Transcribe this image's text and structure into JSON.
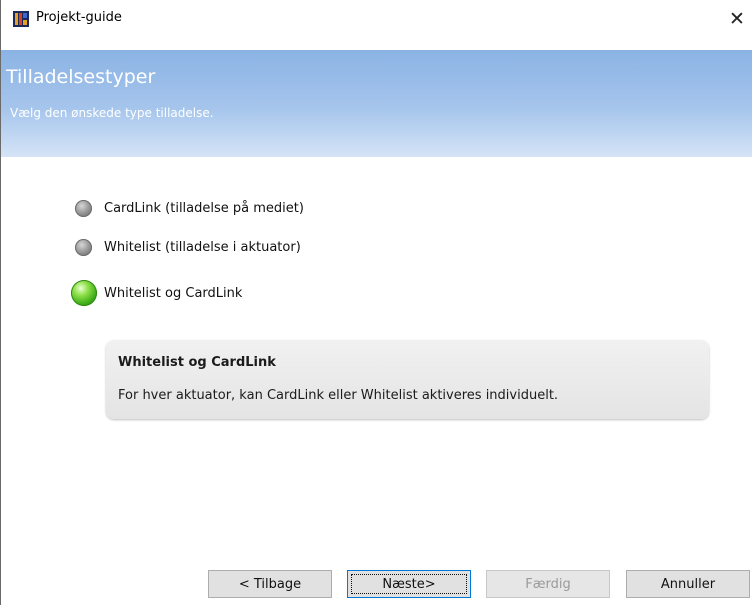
{
  "window": {
    "title": "Projekt-guide",
    "close_symbol": "✕"
  },
  "header": {
    "title": "Tilladelsestyper",
    "subtitle": "Vælg den ønskede type tilladelse."
  },
  "options": [
    {
      "label": "CardLink (tilladelse på mediet)",
      "selected": false
    },
    {
      "label": "Whitelist (tilladelse  i aktuator)",
      "selected": false
    },
    {
      "label": "Whitelist og CardLink",
      "selected": true
    }
  ],
  "info": {
    "title": "Whitelist og CardLink",
    "text": "For hver aktuator, kan CardLink eller Whitelist aktiveres individuelt."
  },
  "buttons": {
    "back": "< Tilbage",
    "next": "Næste>",
    "finish": "Færdig",
    "cancel": "Annuller"
  },
  "colors": {
    "header_top": "#8ab3e4",
    "header_bottom": "#d5e4f7",
    "selected_radio": "#3fae18",
    "focus_border": "#0078d7"
  },
  "icons": {
    "app": "app-icon",
    "close": "close-icon"
  }
}
